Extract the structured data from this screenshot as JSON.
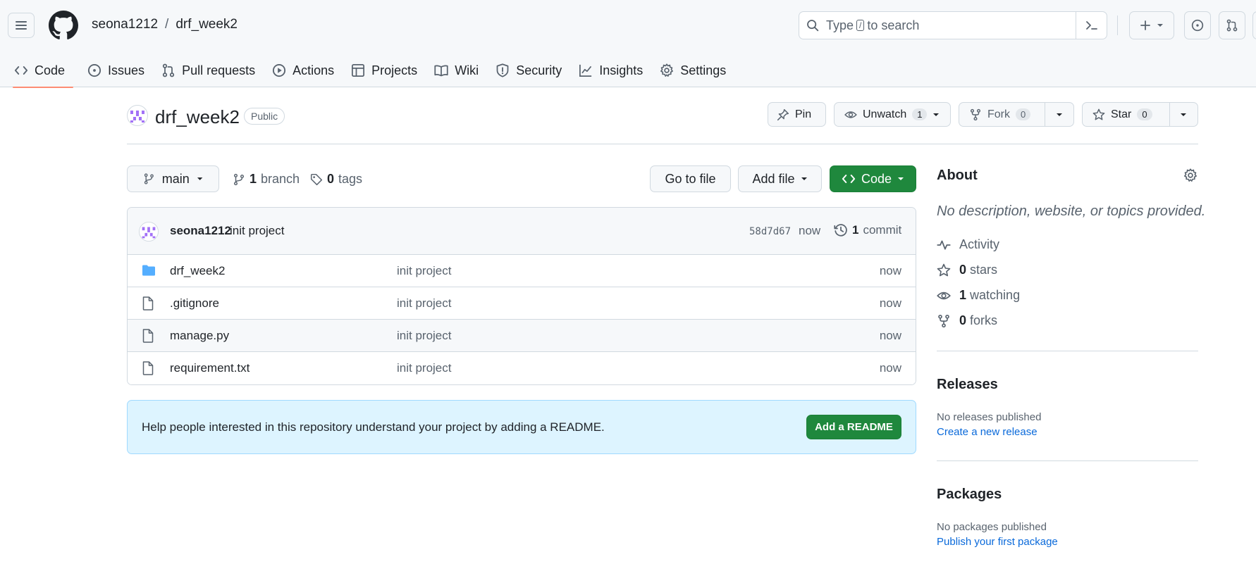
{
  "header": {
    "owner": "seona1212",
    "separator": "/",
    "repo": "drf_week2",
    "search": {
      "prefix": "Type",
      "key": "/",
      "suffix": "to search"
    }
  },
  "tabs": [
    {
      "label": "Code",
      "icon": "code-icon",
      "active": true
    },
    {
      "label": "Issues",
      "icon": "issue-icon"
    },
    {
      "label": "Pull requests",
      "icon": "pull-request-icon"
    },
    {
      "label": "Actions",
      "icon": "play-icon"
    },
    {
      "label": "Projects",
      "icon": "table-icon"
    },
    {
      "label": "Wiki",
      "icon": "book-icon"
    },
    {
      "label": "Security",
      "icon": "shield-icon"
    },
    {
      "label": "Insights",
      "icon": "graph-icon"
    },
    {
      "label": "Settings",
      "icon": "gear-icon"
    }
  ],
  "repo_head": {
    "name": "drf_week2",
    "visibility": "Public",
    "pin_label": "Pin",
    "unwatch_label": "Unwatch",
    "watch_count": "1",
    "fork_label": "Fork",
    "fork_count": "0",
    "star_label": "Star",
    "star_count": "0"
  },
  "file_nav": {
    "branch": "main",
    "branch_count": "1",
    "branch_label": "branch",
    "tag_count": "0",
    "tag_label": "tags",
    "go_to_file": "Go to file",
    "add_file": "Add file",
    "code": "Code"
  },
  "commit": {
    "user": "seona1212",
    "message": "init project",
    "sha": "58d7d67",
    "time": "now",
    "count": "1",
    "count_label": "commit"
  },
  "files": [
    {
      "name": "drf_week2",
      "type": "dir",
      "message": "init project",
      "time": "now"
    },
    {
      "name": ".gitignore",
      "type": "file",
      "message": "init project",
      "time": "now"
    },
    {
      "name": "manage.py",
      "type": "file",
      "message": "init project",
      "time": "now"
    },
    {
      "name": "requirement.txt",
      "type": "file",
      "message": "init project",
      "time": "now"
    }
  ],
  "readme": {
    "text": "Help people interested in this repository understand your project by adding a README.",
    "button": "Add a README"
  },
  "about": {
    "title": "About",
    "description": "No description, website, or topics provided.",
    "activity": "Activity",
    "stars_count": "0",
    "stars_label": "stars",
    "watching_count": "1",
    "watching_label": "watching",
    "forks_count": "0",
    "forks_label": "forks"
  },
  "releases": {
    "title": "Releases",
    "empty": "No releases published",
    "link": "Create a new release"
  },
  "packages": {
    "title": "Packages",
    "empty": "No packages published",
    "link": "Publish your first package"
  },
  "colors": {
    "accent_green": "#1f883d",
    "link_blue": "#0969da",
    "tab_underline": "#fd8c73",
    "folder_blue": "#54aeff",
    "avatar_purple": "#a371f7"
  }
}
